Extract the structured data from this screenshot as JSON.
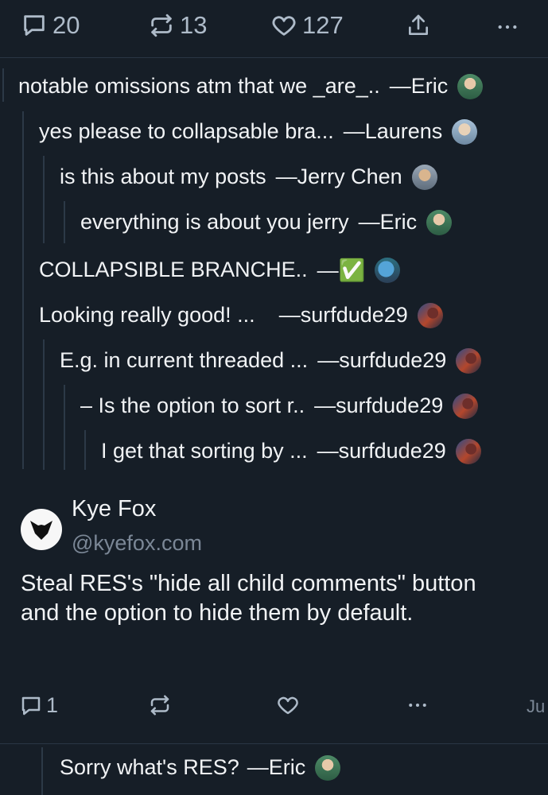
{
  "top_actions": {
    "reply_count": "20",
    "repost_count": "13",
    "like_count": "127"
  },
  "thread": [
    {
      "text": "notable omissions atm that we _are_..",
      "author": "—Eric"
    },
    {
      "text": "yes please to collapsable bra...",
      "author": "—Laurens"
    },
    {
      "text": "is this about my posts",
      "author": "—Jerry Chen"
    },
    {
      "text": "everything is about you jerry",
      "author": "—Eric"
    },
    {
      "text": "COLLAPSIBLE BRANCHE..",
      "author": "—✅"
    },
    {
      "text": "Looking really good! ...",
      "author": "—surfdude29"
    },
    {
      "text": "E.g. in current threaded ...",
      "author": "—surfdude29"
    },
    {
      "text": "– Is the option to sort r..",
      "author": "—surfdude29"
    },
    {
      "text": "I get that sorting by ...",
      "author": "—surfdude29"
    }
  ],
  "post": {
    "name": "Kye Fox",
    "handle": "@kyefox.com",
    "body": "Steal RES's \"hide all child comments\" button and the option to hide them by default.",
    "reply_count": "1",
    "date": "Ju"
  },
  "reply": {
    "text": "Sorry what's RES?",
    "author": "—Eric"
  },
  "colors": {
    "background": "#161e27",
    "text": "#f1f3f5",
    "muted": "#7b8796",
    "icon": "#aebbc9",
    "thread_line": "#2c3947"
  }
}
